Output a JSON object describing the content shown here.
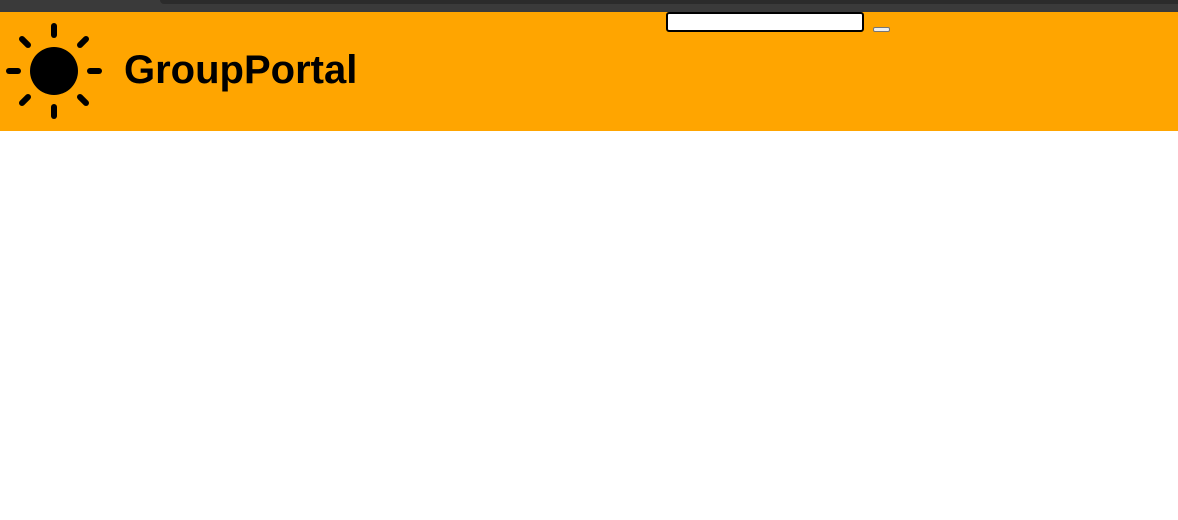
{
  "header": {
    "title": "GroupPortal",
    "logo_icon": "sun-icon",
    "background_color": "#ffa500"
  },
  "search": {
    "value": "",
    "placeholder": "",
    "button_label": ""
  }
}
